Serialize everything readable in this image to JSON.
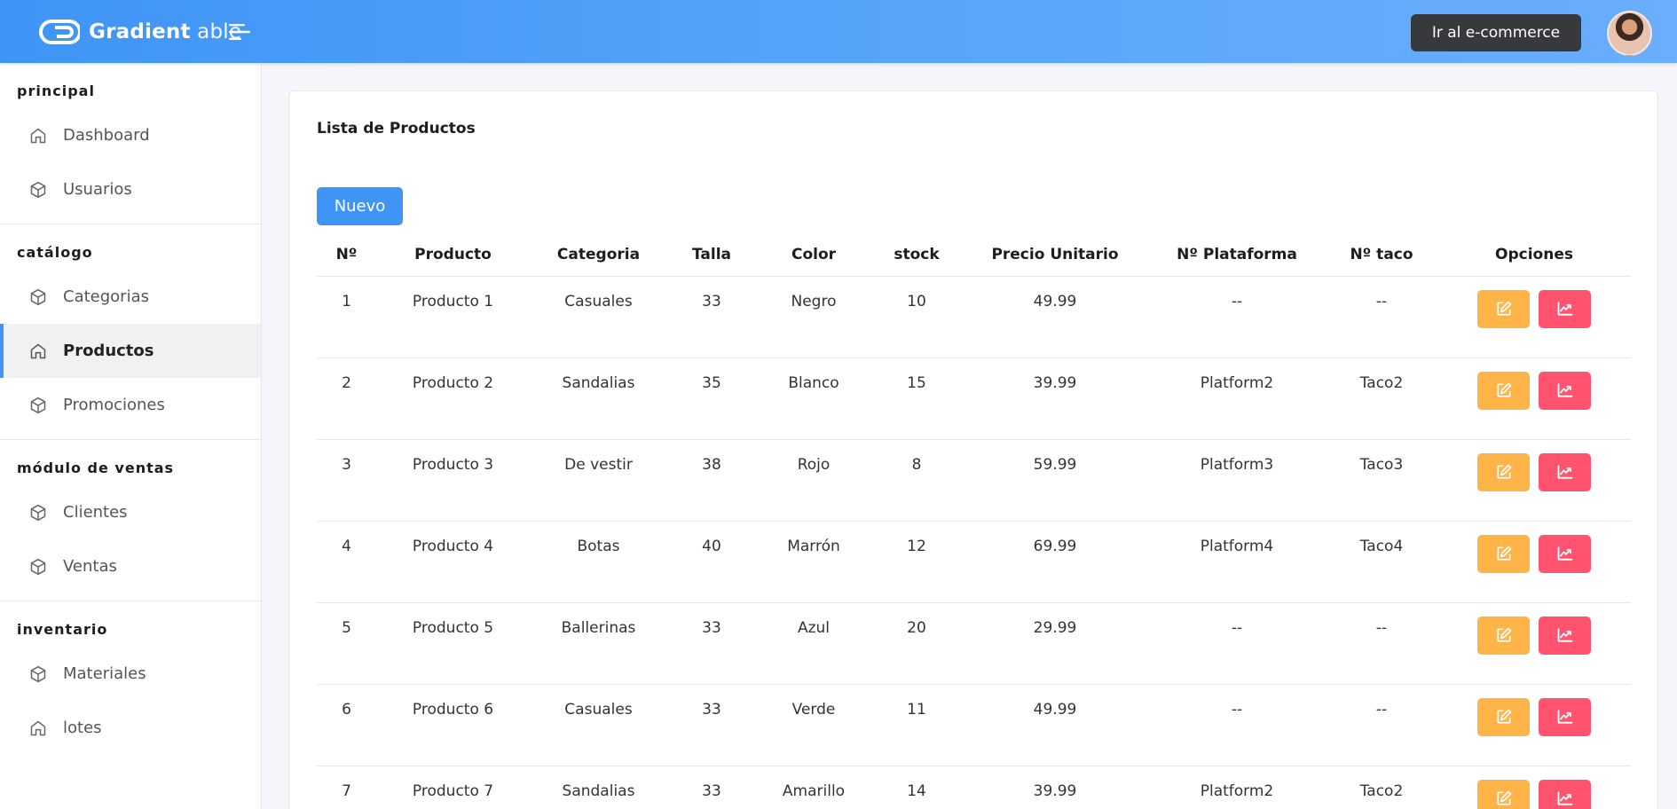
{
  "header": {
    "brand_bold": "Gradient",
    "brand_light": " able",
    "ecommerce_label": "Ir al e-commerce"
  },
  "sidebar": {
    "sections": [
      {
        "title": "principal",
        "items": [
          {
            "label": "Dashboard",
            "icon": "home-icon",
            "active": false
          },
          {
            "label": "Usuarios",
            "icon": "box-icon",
            "active": false
          }
        ]
      },
      {
        "title": "catálogo",
        "items": [
          {
            "label": "Categorias",
            "icon": "box-icon",
            "active": false
          },
          {
            "label": "Productos",
            "icon": "home-icon",
            "active": true
          },
          {
            "label": "Promociones",
            "icon": "box-icon",
            "active": false
          }
        ]
      },
      {
        "title": "módulo de ventas",
        "items": [
          {
            "label": "Clientes",
            "icon": "box-icon",
            "active": false
          },
          {
            "label": "Ventas",
            "icon": "box-icon",
            "active": false
          }
        ]
      },
      {
        "title": "inventario",
        "items": [
          {
            "label": "Materiales",
            "icon": "box-icon",
            "active": false
          },
          {
            "label": "lotes",
            "icon": "home-icon",
            "active": false
          }
        ]
      }
    ]
  },
  "main": {
    "title": "Lista de Productos",
    "new_label": "Nuevo",
    "columns": [
      "Nº",
      "Producto",
      "Categoria",
      "Talla",
      "Color",
      "stock",
      "Precio Unitario",
      "Nº Plataforma",
      "Nº taco",
      "Opciones"
    ],
    "rows": [
      [
        "1",
        "Producto 1",
        "Casuales",
        "33",
        "Negro",
        "10",
        "49.99",
        "--",
        "--"
      ],
      [
        "2",
        "Producto 2",
        "Sandalias",
        "35",
        "Blanco",
        "15",
        "39.99",
        "Platform2",
        "Taco2"
      ],
      [
        "3",
        "Producto 3",
        "De vestir",
        "38",
        "Rojo",
        "8",
        "59.99",
        "Platform3",
        "Taco3"
      ],
      [
        "4",
        "Producto 4",
        "Botas",
        "40",
        "Marrón",
        "12",
        "69.99",
        "Platform4",
        "Taco4"
      ],
      [
        "5",
        "Producto 5",
        "Ballerinas",
        "33",
        "Azul",
        "20",
        "29.99",
        "--",
        "--"
      ],
      [
        "6",
        "Producto 6",
        "Casuales",
        "33",
        "Verde",
        "11",
        "49.99",
        "--",
        "--"
      ],
      [
        "7",
        "Producto 7",
        "Sandalias",
        "33",
        "Amarillo",
        "14",
        "39.99",
        "Platform2",
        "Taco2"
      ]
    ]
  },
  "colors": {
    "primary": "#3f94f5",
    "edit": "#ffb448",
    "stats": "#ff5370",
    "dark_button": "#37393d"
  }
}
